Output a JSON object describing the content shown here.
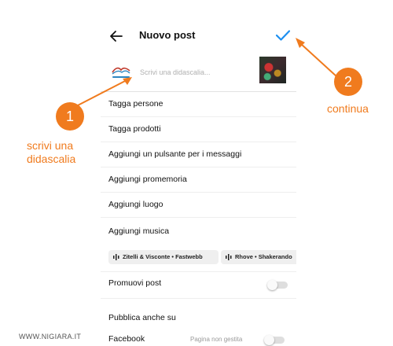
{
  "header": {
    "title": "Nuovo post",
    "back_icon": "arrow-left-icon",
    "confirm_icon": "checkmark-icon",
    "confirm_color": "#1d8ff0"
  },
  "compose": {
    "caption_placeholder": "Scrivi una didascalia...",
    "caption_value": "",
    "avatar_icon": "nigiara-logo"
  },
  "menu": {
    "items": [
      {
        "label": "Tagga persone"
      },
      {
        "label": "Tagga prodotti"
      },
      {
        "label": "Aggiungi un pulsante per i messaggi"
      },
      {
        "label": "Aggiungi promemoria"
      },
      {
        "label": "Aggiungi luogo"
      },
      {
        "label": "Aggiungi musica"
      }
    ]
  },
  "music_suggestions": [
    {
      "label": "Zitelli & Visconte • Fastwebb",
      "icon": "music-bars-icon"
    },
    {
      "label": "Rhove • Shakerando",
      "icon": "music-bars-icon"
    }
  ],
  "promote": {
    "label": "Promuovi post",
    "enabled": false
  },
  "share": {
    "section_title": "Pubblica anche su",
    "facebook_label": "Facebook",
    "facebook_status": "Pagina non gestita",
    "facebook_enabled": false
  },
  "annotations": {
    "step1_number": "1",
    "step1_text_line1": "scrivi una",
    "step1_text_line2": "didascalia",
    "step2_number": "2",
    "step2_text": "continua",
    "accent_color": "#f07b1e"
  },
  "watermark": "WWW.NIGIARA.IT"
}
